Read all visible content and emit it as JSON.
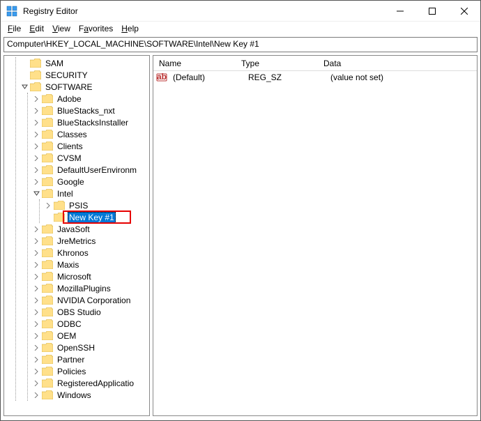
{
  "window": {
    "title": "Registry Editor",
    "minimize": "–",
    "maximize": "▢",
    "close": "✕"
  },
  "menubar": {
    "file": "File",
    "edit": "Edit",
    "view": "View",
    "favorites": "Favorites",
    "help": "Help"
  },
  "address": "Computer\\HKEY_LOCAL_MACHINE\\SOFTWARE\\Intel\\New Key #1",
  "tree": {
    "sam": "SAM",
    "security": "SECURITY",
    "software": "SOFTWARE",
    "software_children": {
      "adobe": "Adobe",
      "bluestacks_nxt": "BlueStacks_nxt",
      "bluestacksinstaller": "BlueStacksInstaller",
      "classes": "Classes",
      "clients": "Clients",
      "cvsm": "CVSM",
      "defaultuserenvironment": "DefaultUserEnvironm",
      "google": "Google",
      "intel": "Intel",
      "intel_children": {
        "psis": "PSIS",
        "newkey1": "New Key #1"
      },
      "javasoft": "JavaSoft",
      "jremetrics": "JreMetrics",
      "khronos": "Khronos",
      "maxis": "Maxis",
      "microsoft": "Microsoft",
      "mozillaplugins": "MozillaPlugins",
      "nvidia_corporation": "NVIDIA Corporation",
      "obs_studio": "OBS Studio",
      "odbc": "ODBC",
      "oem": "OEM",
      "openssh": "OpenSSH",
      "partner": "Partner",
      "policies": "Policies",
      "registeredapplications": "RegisteredApplicatio",
      "windows": "Windows"
    }
  },
  "list": {
    "header": {
      "name": "Name",
      "type": "Type",
      "data": "Data"
    },
    "rows": [
      {
        "name": "(Default)",
        "type": "REG_SZ",
        "data": "(value not set)"
      }
    ]
  }
}
